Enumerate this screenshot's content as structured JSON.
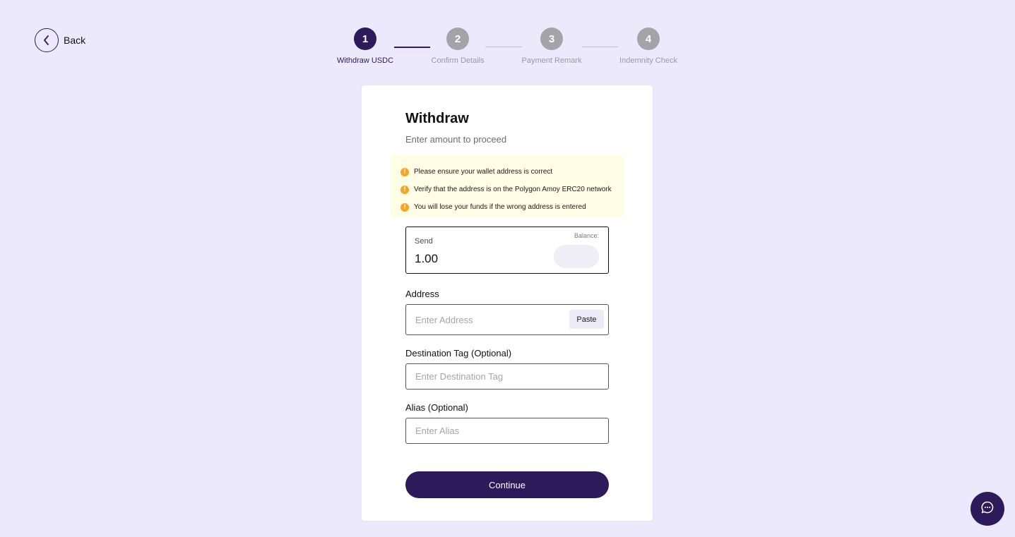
{
  "nav": {
    "back_label": "Back"
  },
  "stepper": {
    "steps": [
      {
        "number": "1",
        "label": "Withdraw USDC",
        "active": true
      },
      {
        "number": "2",
        "label": "Confirm Details",
        "active": false
      },
      {
        "number": "3",
        "label": "Payment Remark",
        "active": false
      },
      {
        "number": "4",
        "label": "Indemnity Check",
        "active": false
      }
    ]
  },
  "form": {
    "title": "Withdraw",
    "subtitle": "Enter amount to proceed",
    "notices": [
      "Please ensure your wallet address is correct",
      "Verify that the address is on the Polygon Amoy ERC20 network",
      "You will lose your funds if the wrong address is entered"
    ],
    "send": {
      "label": "Send",
      "value": "1.00",
      "balance_label": "Balance:"
    },
    "address": {
      "label": "Address",
      "placeholder": "Enter Address",
      "value": "",
      "paste_label": "Paste"
    },
    "destination_tag": {
      "label": "Destination Tag (Optional)",
      "placeholder": "Enter Destination Tag",
      "value": ""
    },
    "alias": {
      "label": "Alias (Optional)",
      "placeholder": "Enter Alias",
      "value": ""
    },
    "continue_label": "Continue"
  },
  "colors": {
    "background": "#ece9fc",
    "primary": "#2d1a5a",
    "inactive_step": "#a3a3a8",
    "notice_bg": "#fffde6",
    "warning": "#f5a524"
  },
  "icons": {
    "back": "chevron-left-icon",
    "warning": "exclamation-circle-icon",
    "chat": "chat-bubble-icon"
  }
}
